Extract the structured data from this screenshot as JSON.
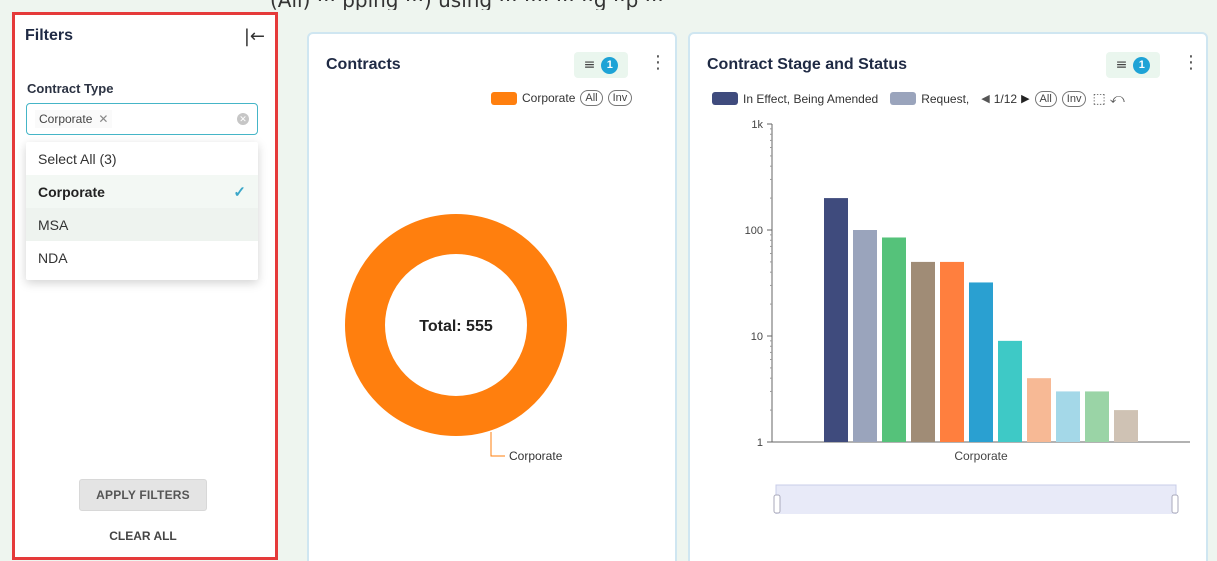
{
  "caption_partial": "(All) ··· pping ···) using ··· ···· ··· ··g ··p ···",
  "filters": {
    "title": "Filters",
    "collapse_icon": "collapse-left-icon",
    "field_label": "Contract Type",
    "selected_chip": "Corporate",
    "dropdown_options": [
      {
        "label": "Select All (3)"
      },
      {
        "label": "Corporate",
        "selected": true
      },
      {
        "label": "MSA"
      },
      {
        "label": "NDA"
      }
    ],
    "apply_label": "APPLY FILTERS",
    "clear_label": "CLEAR ALL",
    "border_color": "#e53a3a"
  },
  "contracts_card": {
    "title": "Contracts",
    "filter_count": "1",
    "legend_label": "Corporate",
    "all_label": "All",
    "inv_label": "Inv",
    "center_label": "Total: 555",
    "slice_label": "Corporate",
    "accent": "#ff7f0e"
  },
  "stage_card": {
    "title": "Contract Stage and Status",
    "filter_count": "1",
    "legend_1": "In Effect, Being Amended",
    "legend_2": "Request,",
    "pager": "1/12",
    "all_label": "All",
    "inv_label": "Inv"
  },
  "chart_data": [
    {
      "type": "pie",
      "categories": [
        "Corporate"
      ],
      "values": [
        555
      ],
      "title": "Contracts",
      "annotation": "Total: 555",
      "colors": [
        "#ff7f0e"
      ]
    },
    {
      "type": "bar",
      "title": "Contract Stage and Status",
      "categories": [
        "Corporate"
      ],
      "xlabel": "",
      "ylabel": "",
      "yscale": "log",
      "ylim": [
        1,
        1000
      ],
      "yticks": [
        "1",
        "10",
        "100",
        "1k"
      ],
      "series": [
        {
          "name": "In Effect, Being Amended",
          "values": [
            200
          ],
          "color": "#3f4b7d"
        },
        {
          "name": "Request,",
          "values": [
            100
          ],
          "color": "#9aa4bc"
        },
        {
          "values": [
            85
          ],
          "color": "#55c27a"
        },
        {
          "values": [
            50
          ],
          "color": "#a08c76"
        },
        {
          "values": [
            50
          ],
          "color": "#ff7f3e"
        },
        {
          "values": [
            32
          ],
          "color": "#2aa0d1"
        },
        {
          "values": [
            9
          ],
          "color": "#3ec9c6"
        },
        {
          "values": [
            4
          ],
          "color": "#f7b995"
        },
        {
          "values": [
            3
          ],
          "color": "#a4d8e8"
        },
        {
          "values": [
            3
          ],
          "color": "#9ad4a6"
        },
        {
          "values": [
            2
          ],
          "color": "#cfc2b4"
        }
      ]
    }
  ]
}
